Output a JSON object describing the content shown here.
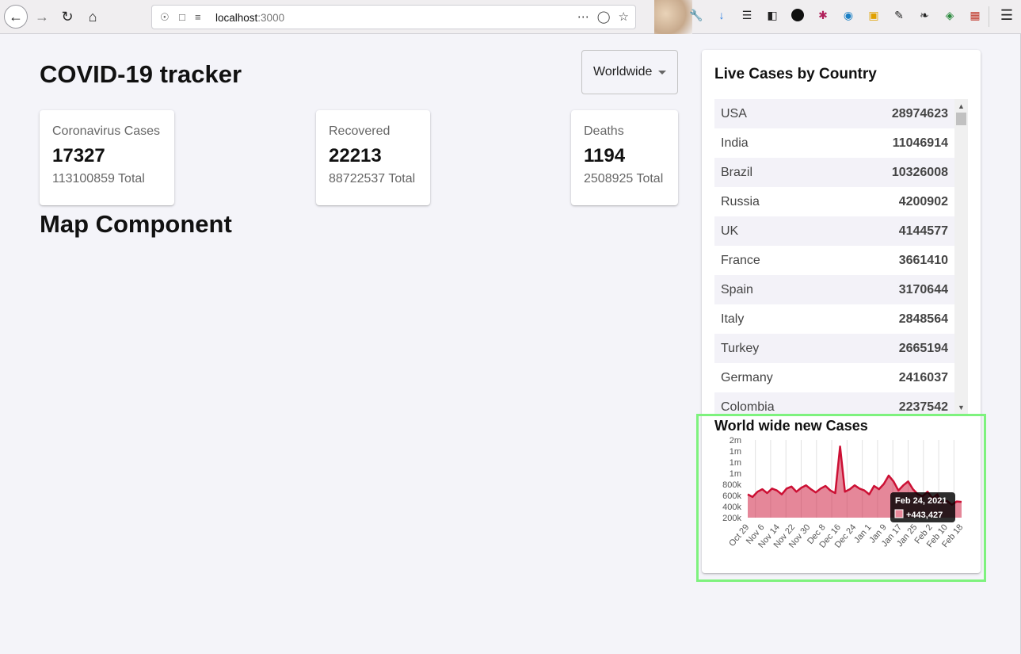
{
  "browser": {
    "url_host": "localhost",
    "url_port": ":3000"
  },
  "app": {
    "title": "COVID-19 tracker",
    "region_selected": "Worldwide",
    "map_title": "Map Component"
  },
  "stats": {
    "cases": {
      "label": "Coronavirus Cases",
      "value": "17327",
      "total": "113100859 Total"
    },
    "recovered": {
      "label": "Recovered",
      "value": "22213",
      "total": "88722537 Total"
    },
    "deaths": {
      "label": "Deaths",
      "value": "1194",
      "total": "2508925 Total"
    }
  },
  "table": {
    "title": "Live Cases by Country",
    "rows": [
      {
        "country": "USA",
        "cases": "28974623"
      },
      {
        "country": "India",
        "cases": "11046914"
      },
      {
        "country": "Brazil",
        "cases": "10326008"
      },
      {
        "country": "Russia",
        "cases": "4200902"
      },
      {
        "country": "UK",
        "cases": "4144577"
      },
      {
        "country": "France",
        "cases": "3661410"
      },
      {
        "country": "Spain",
        "cases": "3170644"
      },
      {
        "country": "Italy",
        "cases": "2848564"
      },
      {
        "country": "Turkey",
        "cases": "2665194"
      },
      {
        "country": "Germany",
        "cases": "2416037"
      },
      {
        "country": "Colombia",
        "cases": "2237542"
      }
    ]
  },
  "chart_data": {
    "type": "area",
    "title": "World wide new Cases",
    "xlabel": "",
    "ylabel": "",
    "y_tick_labels": [
      "2m",
      "1m",
      "1m",
      "1m",
      "800k",
      "600k",
      "400k",
      "200k"
    ],
    "y_tick_values": [
      1400000,
      1200000,
      1000000,
      1000000,
      800000,
      600000,
      400000,
      200000
    ],
    "ylim": [
      200000,
      1400000
    ],
    "x_tick_labels": [
      "Oct 29",
      "Nov 6",
      "Nov 14",
      "Nov 22",
      "Nov 30",
      "Dec 8",
      "Dec 16",
      "Dec 24",
      "Jan 1",
      "Jan 9",
      "Jan 17",
      "Jan 25",
      "Feb 2",
      "Feb 10",
      "Feb 18"
    ],
    "grid": true,
    "color": "#cc1034",
    "fill_color": "rgba(204,16,52,0.5)",
    "series": [
      {
        "values": [
          560000,
          520000,
          600000,
          640000,
          580000,
          650000,
          620000,
          560000,
          650000,
          680000,
          600000,
          660000,
          700000,
          640000,
          590000,
          650000,
          690000,
          620000,
          580000,
          1300000,
          600000,
          640000,
          700000,
          650000,
          620000,
          560000,
          690000,
          640000,
          720000,
          850000,
          760000,
          620000,
          700000,
          760000,
          640000,
          560000,
          530000,
          600000,
          500000,
          560000,
          420000,
          460000,
          400000,
          450000,
          443427
        ]
      }
    ],
    "tooltip": {
      "date": "Feb 24, 2021",
      "value": "+443,427"
    }
  }
}
